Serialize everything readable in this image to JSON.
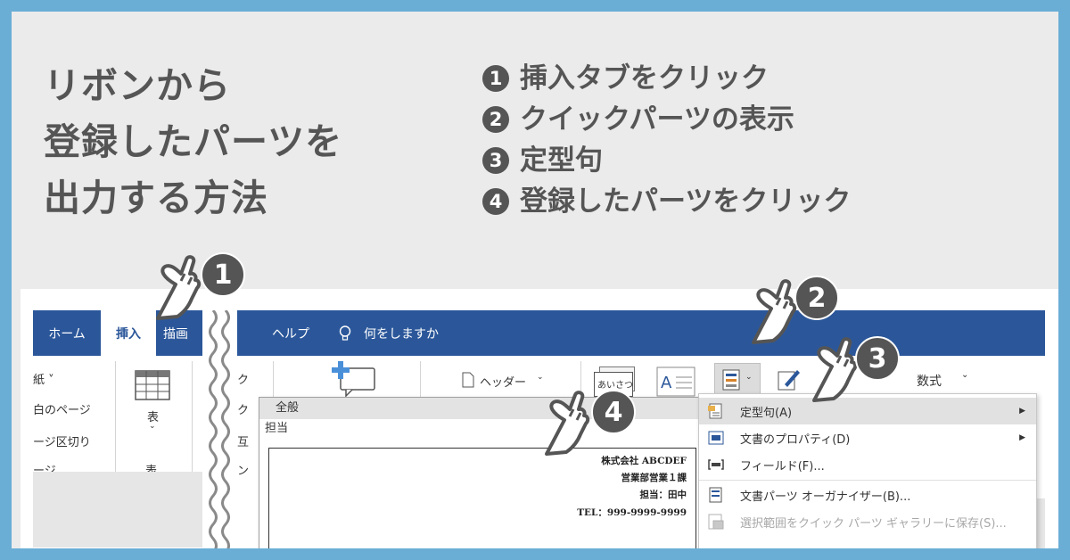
{
  "heading": {
    "line1": "リボンから",
    "line2": "登録したパーツを",
    "line3": "出力する方法"
  },
  "steps": [
    {
      "num": "1",
      "text": "挿入タブをクリック"
    },
    {
      "num": "2",
      "text": "クイックパーツの表示"
    },
    {
      "num": "3",
      "text": "定型句"
    },
    {
      "num": "4",
      "text": "登録したパーツをクリック"
    }
  ],
  "ribbon": {
    "tabs_left": [
      "ホーム",
      "挿入",
      "描画"
    ],
    "tabs_right": {
      "help": "ヘルプ",
      "search": "何をしますか"
    },
    "left_items": [
      "紙 ˅",
      "白のページ",
      "ージ区切り",
      "ージ"
    ],
    "table_button": {
      "label": "表",
      "group": "表"
    },
    "cut_labels": [
      "ク",
      "ク",
      "互",
      "ン"
    ],
    "header_button": "ヘッダー",
    "greeting_label": "あいさつ",
    "formula_label": "数式"
  },
  "gallery": {
    "category": "全般",
    "item_name": "担当",
    "preview_lines": [
      "株式会社 ABCDEF",
      "営業部営業１課",
      "担当：田中",
      "TEL：999-9999-9999"
    ]
  },
  "quickparts_menu": {
    "items": [
      {
        "label": "定型句(A)",
        "has_submenu": true,
        "highlight": true,
        "disabled": false,
        "icon": "autotext-icon"
      },
      {
        "label": "文書のプロパティ(D)",
        "has_submenu": true,
        "highlight": false,
        "disabled": false,
        "icon": "doc-property-icon"
      },
      {
        "label": "フィールド(F)...",
        "has_submenu": false,
        "highlight": false,
        "disabled": false,
        "icon": "field-icon"
      },
      {
        "label": "文書パーツ オーガナイザー(B)...",
        "has_submenu": false,
        "highlight": false,
        "disabled": false,
        "icon": "organizer-icon"
      },
      {
        "label": "選択範囲をクイック パーツ ギャラリーに保存(S)...",
        "has_submenu": false,
        "highlight": false,
        "disabled": true,
        "icon": "save-gallery-icon"
      }
    ]
  },
  "badges": [
    "1",
    "2",
    "3",
    "4"
  ],
  "colors": {
    "ribbon_blue": "#2b579a",
    "border_blue": "#6aaed6",
    "text_grey": "#555555",
    "menu_highlight": "#e1e1e1"
  }
}
